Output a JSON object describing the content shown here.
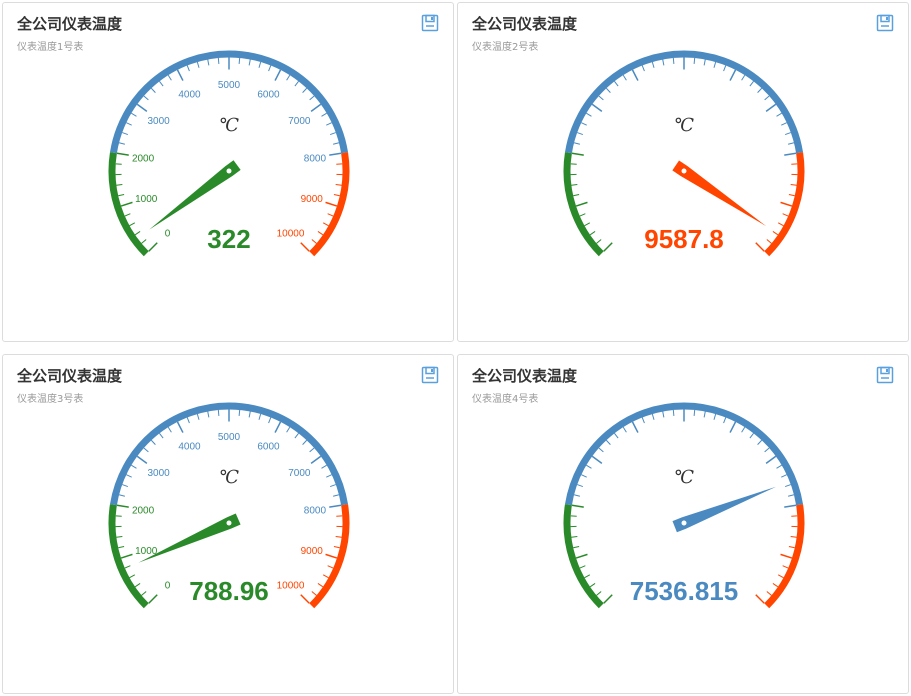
{
  "toolbar": {
    "save_icon": "save-icon"
  },
  "colors": {
    "green": "#2a8a2a",
    "blue": "#4a8ac0",
    "red": "#ff4500",
    "icon": "#5aa0de"
  },
  "chart_data": [
    {
      "type": "gauge",
      "title": "全公司仪表温度",
      "subtitle": "仪表温度1号表",
      "unit": "℃",
      "min": 0,
      "max": 10000,
      "value": 322,
      "value_label": "322",
      "bands": [
        {
          "to": 0.2,
          "color": "#2a8a2a"
        },
        {
          "to": 0.8,
          "color": "#4a8ac0"
        },
        {
          "to": 1,
          "color": "#ff4500"
        }
      ],
      "show_tick_labels": true,
      "tick_labels": [
        "0",
        "1000",
        "2000",
        "3000",
        "4000",
        "5000",
        "6000",
        "7000",
        "8000",
        "9000",
        "10000"
      ]
    },
    {
      "type": "gauge",
      "title": "全公司仪表温度",
      "subtitle": "仪表温度2号表",
      "unit": "℃",
      "min": 0,
      "max": 10000,
      "value": 9587.8,
      "value_label": "9587.8",
      "bands": [
        {
          "to": 0.2,
          "color": "#2a8a2a"
        },
        {
          "to": 0.8,
          "color": "#4a8ac0"
        },
        {
          "to": 1,
          "color": "#ff4500"
        }
      ],
      "show_tick_labels": false,
      "tick_labels": []
    },
    {
      "type": "gauge",
      "title": "全公司仪表温度",
      "subtitle": "仪表温度3号表",
      "unit": "℃",
      "min": 0,
      "max": 10000,
      "value": 788.96,
      "value_label": "788.96",
      "bands": [
        {
          "to": 0.2,
          "color": "#2a8a2a"
        },
        {
          "to": 0.8,
          "color": "#4a8ac0"
        },
        {
          "to": 1,
          "color": "#ff4500"
        }
      ],
      "show_tick_labels": true,
      "tick_labels": [
        "0",
        "1000",
        "2000",
        "3000",
        "4000",
        "5000",
        "6000",
        "7000",
        "8000",
        "9000",
        "10000"
      ]
    },
    {
      "type": "gauge",
      "title": "全公司仪表温度",
      "subtitle": "仪表温度4号表",
      "unit": "℃",
      "min": 0,
      "max": 10000,
      "value": 7536.815,
      "value_label": "7536.815",
      "bands": [
        {
          "to": 0.2,
          "color": "#2a8a2a"
        },
        {
          "to": 0.8,
          "color": "#4a8ac0"
        },
        {
          "to": 1,
          "color": "#ff4500"
        }
      ],
      "show_tick_labels": false,
      "tick_labels": []
    }
  ]
}
